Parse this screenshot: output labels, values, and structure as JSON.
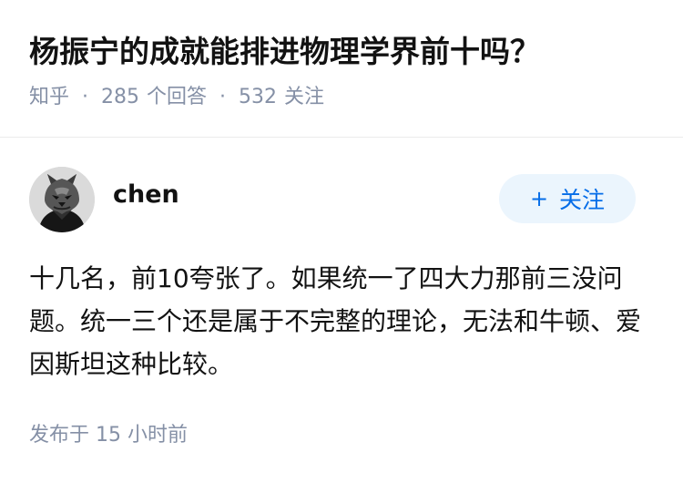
{
  "question": {
    "title": "杨振宁的成就能排进物理学界前十吗？",
    "source": "知乎",
    "separator": "·",
    "answer_count": "285",
    "answer_label": "个回答",
    "follower_count": "532",
    "follower_label": "关注"
  },
  "answer": {
    "author": {
      "name": "chen",
      "avatar_icon": "wolf-mask-avatar-icon"
    },
    "follow_button": {
      "icon": "+",
      "label": "关注"
    },
    "content": "十几名，前10夸张了。如果统一了四大力那前三没问题。统一三个还是属于不完整的理论，无法和牛顿、爱因斯坦这种比较。",
    "time_prefix": "发布于",
    "time_value": "15",
    "time_unit": "小时前"
  },
  "colors": {
    "text": "#121212",
    "meta": "#8590a6",
    "accent": "#056de8",
    "follow_bg": "#ebf5fd",
    "divider": "#ebebeb"
  }
}
